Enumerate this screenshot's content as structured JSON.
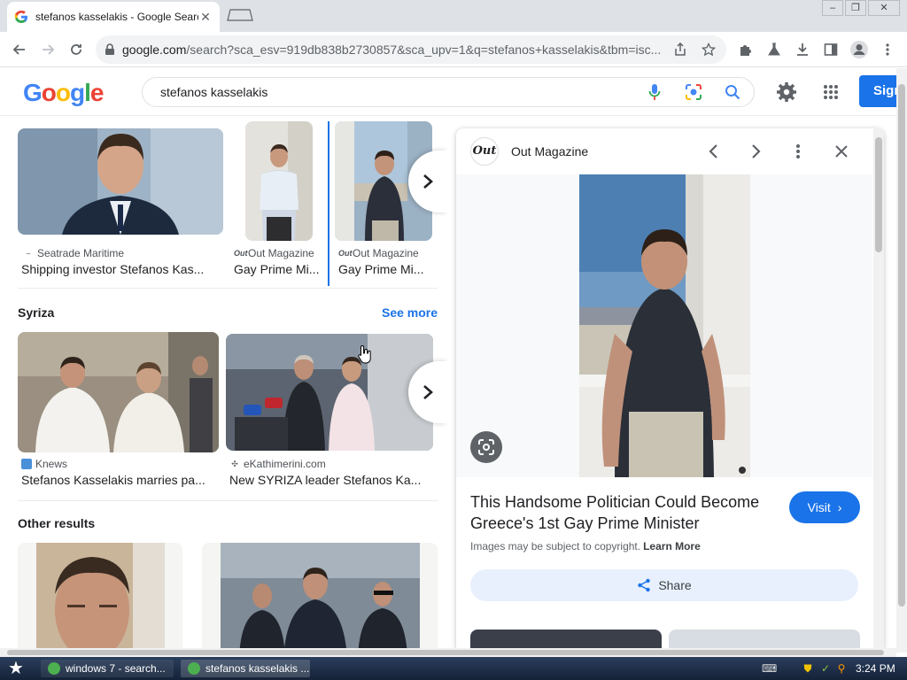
{
  "browser": {
    "tab_title": "stefanos kasselakis - Google Search",
    "url_host": "google.com",
    "url_path": "/search?sca_esv=919db838b2730857&sca_upv=1&q=stefanos+kasselakis&tbm=isc..."
  },
  "google": {
    "query": "stefanos kasselakis",
    "sign_in_label": "Sign"
  },
  "top_row": [
    {
      "source": "Seatrade Maritime",
      "title": "Shipping investor Stefanos Kas..."
    },
    {
      "source": "Out Magazine",
      "title": "Gay Prime Mi..."
    },
    {
      "source": "Out Magazine",
      "title": "Gay Prime Mi..."
    }
  ],
  "syriza": {
    "heading": "Syriza",
    "see_more": "See more",
    "items": [
      {
        "source": "Knews",
        "title": "Stefanos Kasselakis marries pa..."
      },
      {
        "source": "eKathimerini.com",
        "title": "New SYRIZA leader Stefanos Ka..."
      }
    ]
  },
  "other_results": {
    "heading": "Other results"
  },
  "panel": {
    "logo_text": "Out",
    "source": "Out Magazine",
    "title": "This Handsome Politician Could Become Greece's 1st Gay Prime Minister",
    "visit_label": "Visit",
    "copyright_text": "Images may be subject to copyright.",
    "learn_more": "Learn More",
    "share_label": "Share"
  },
  "taskbar": {
    "task1": "windows 7 - search...",
    "task2": "stefanos kasselakis ...",
    "clock": "3:24 PM"
  },
  "colors": {
    "accent": "#1a73e8",
    "taskbar": "#1c2d48"
  }
}
